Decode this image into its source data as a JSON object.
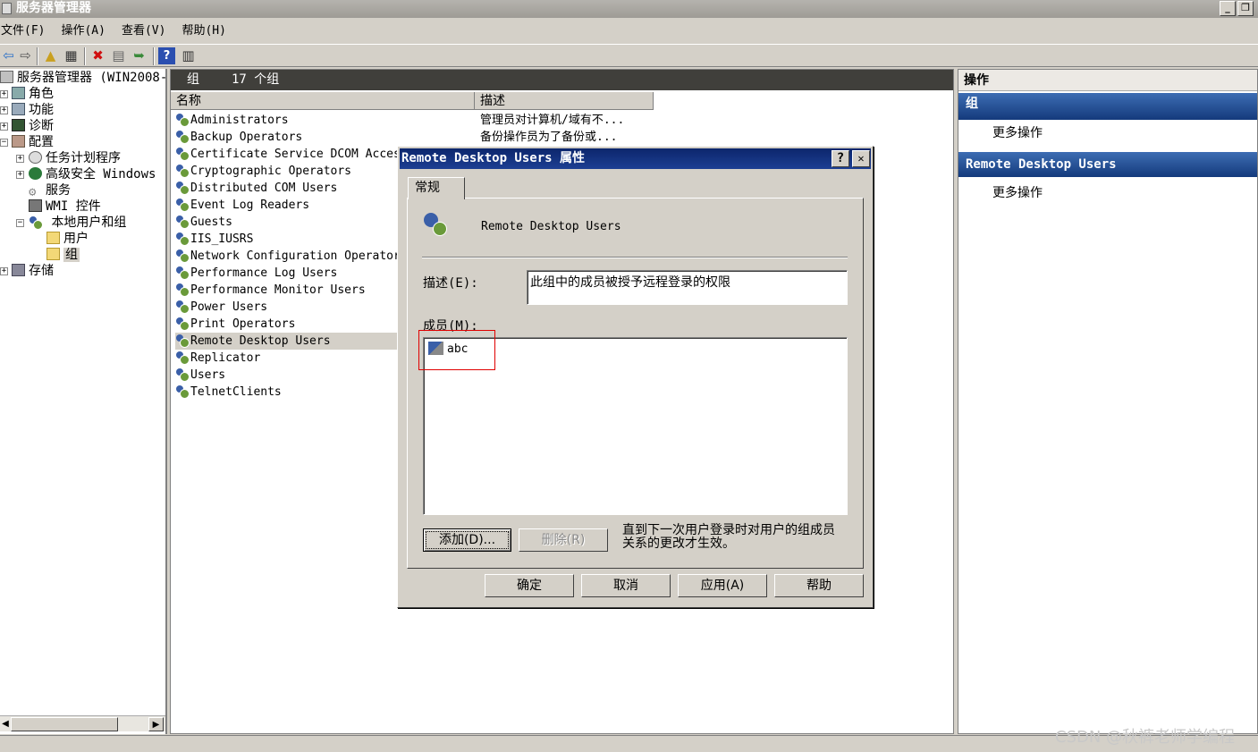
{
  "window": {
    "title": "服务器管理器"
  },
  "menu": [
    "文件(F)",
    "操作(A)",
    "查看(V)",
    "帮助(H)"
  ],
  "toolbar_icons": [
    "back-icon",
    "forward-icon",
    "up-folder-icon",
    "console-tree-icon",
    "delete-icon",
    "properties-icon",
    "export-icon",
    "help-icon",
    "show-action-pane-icon"
  ],
  "tree": {
    "root": "服务器管理器 (WIN2008-",
    "items": [
      "角色",
      "功能",
      "诊断",
      "配置",
      "任务计划程序",
      "高级安全 Windows",
      "服务",
      "WMI 控件",
      "本地用户和组",
      "用户",
      "组",
      "存储"
    ]
  },
  "center": {
    "header_title": "组",
    "header_count": "17 个组",
    "columns": [
      "名称",
      "描述"
    ],
    "groups": [
      {
        "name": "Administrators",
        "desc": "管理员对计算机/域有不..."
      },
      {
        "name": "Backup Operators",
        "desc": "备份操作员为了备份或..."
      },
      {
        "name": "Certificate Service DCOM Access",
        "desc": ""
      },
      {
        "name": "Cryptographic Operators",
        "desc": ""
      },
      {
        "name": "Distributed COM Users",
        "desc": ""
      },
      {
        "name": "Event Log Readers",
        "desc": ""
      },
      {
        "name": "Guests",
        "desc": ""
      },
      {
        "name": "IIS_IUSRS",
        "desc": ""
      },
      {
        "name": "Network Configuration Operators",
        "desc": ""
      },
      {
        "name": "Performance Log Users",
        "desc": ""
      },
      {
        "name": "Performance Monitor Users",
        "desc": ""
      },
      {
        "name": "Power Users",
        "desc": ""
      },
      {
        "name": "Print Operators",
        "desc": ""
      },
      {
        "name": "Remote Desktop Users",
        "desc": ""
      },
      {
        "name": "Replicator",
        "desc": ""
      },
      {
        "name": "Users",
        "desc": ""
      },
      {
        "name": "TelnetClients",
        "desc": ""
      }
    ]
  },
  "actions": {
    "title": "操作",
    "section1": "组",
    "section1_item": "更多操作",
    "section2": "Remote Desktop Users",
    "section2_item": "更多操作"
  },
  "dialog": {
    "title": "Remote Desktop Users 属性",
    "help_btn": "?",
    "close_btn": "✕",
    "tab": "常规",
    "group_name": "Remote Desktop Users",
    "desc_label": "描述(E):",
    "desc_value": "此组中的成员被授予远程登录的权限",
    "members_label": "成员(M):",
    "members": [
      "abc"
    ],
    "add_btn": "添加(D)...",
    "remove_btn": "删除(R)",
    "note": "直到下一次用户登录时对用户的组成员关系的更改才生效。",
    "ok": "确定",
    "cancel": "取消",
    "apply": "应用(A)",
    "help": "帮助"
  },
  "watermark": "CSDN @秋裤老师学编程"
}
